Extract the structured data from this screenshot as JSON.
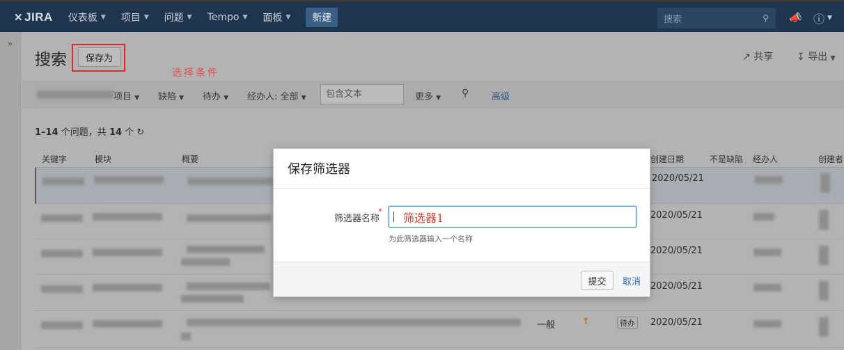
{
  "topnav": {
    "logo_text": "JIRA",
    "items": [
      {
        "label": "仪表板"
      },
      {
        "label": "项目"
      },
      {
        "label": "问题"
      },
      {
        "label": "Tempo"
      },
      {
        "label": "面板"
      }
    ],
    "create_label": "新建",
    "search_placeholder": "搜索"
  },
  "page": {
    "title": "搜索",
    "save_as_label": "保存为",
    "annotation": "选择条件",
    "share_label": "共享",
    "export_label": "导出"
  },
  "filters": {
    "project_label": "项目",
    "type_label": "缺陷",
    "status_label": "待办",
    "assignee_label": "经办人: 全部",
    "text_placeholder": "包含文本",
    "more_label": "更多",
    "advanced_label": "高级"
  },
  "results": {
    "range": "1–14",
    "count_text_mid": "个问题，共",
    "total": "14",
    "count_text_end": "个"
  },
  "table": {
    "headers": {
      "key": "关键字",
      "module": "模块",
      "summary": "概要",
      "created": "创建日期",
      "not_defect": "不是缺陷",
      "assignee": "经办人",
      "creator": "创建者"
    },
    "rows": [
      {
        "created": "2020/05/21"
      },
      {
        "created": "2020/05/21"
      },
      {
        "created": "2020/05/21"
      },
      {
        "created": "2020/05/21"
      },
      {
        "created": "2020/05/21",
        "priority_label": "一般",
        "status": "待办"
      }
    ]
  },
  "dialog": {
    "title": "保存筛选器",
    "field_label": "筛选器名称",
    "required_mark": "*",
    "field_value": "筛选器1",
    "field_description": "为此筛选器输入一个名称",
    "submit_label": "提交",
    "cancel_label": "取消"
  },
  "colors": {
    "topbar": "#1e3550",
    "overlay_gray": "#b3b3b3",
    "annotation_red": "#d92a2a",
    "link_blue": "#3572b0"
  }
}
